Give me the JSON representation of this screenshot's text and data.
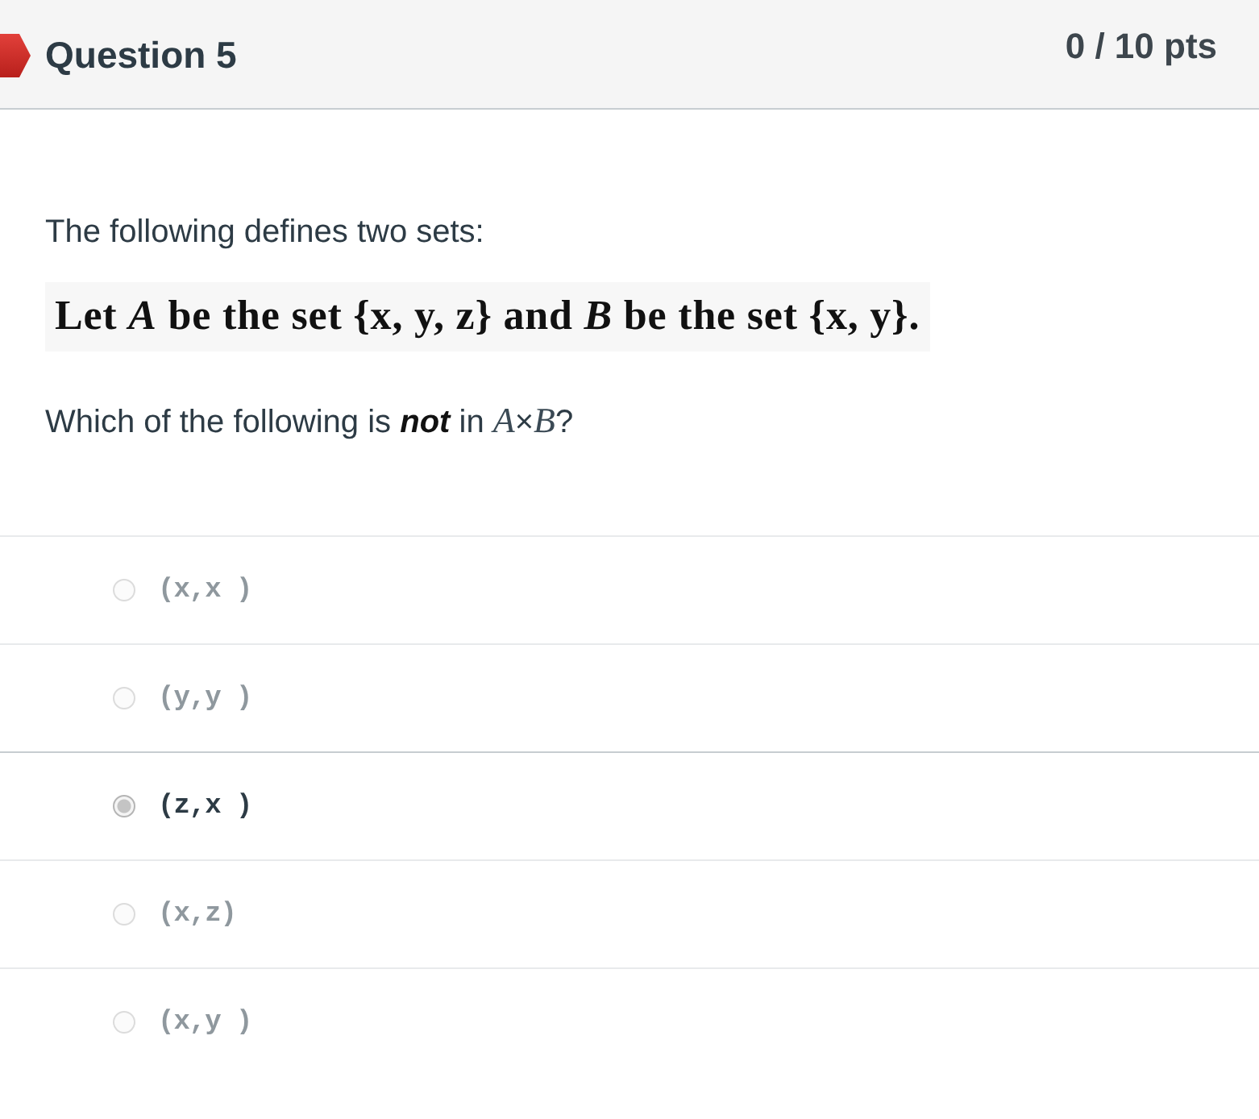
{
  "header": {
    "incorrect": true,
    "title": "Question 5",
    "points": "0 / 10 pts"
  },
  "body": {
    "prompt": "The following defines two sets:",
    "statement": "Let *A* be the set {x, y, z} and *B* be the set {x, y}.",
    "question": "Which of the following is **not** in *A*×*B*?"
  },
  "answers": [
    {
      "label": "(x,x )",
      "selected": false
    },
    {
      "label": "(y,y )",
      "selected": false
    },
    {
      "label": "(z,x )",
      "selected": true
    },
    {
      "label": "(x,z)",
      "selected": false
    },
    {
      "label": "(x,y )",
      "selected": false
    }
  ]
}
